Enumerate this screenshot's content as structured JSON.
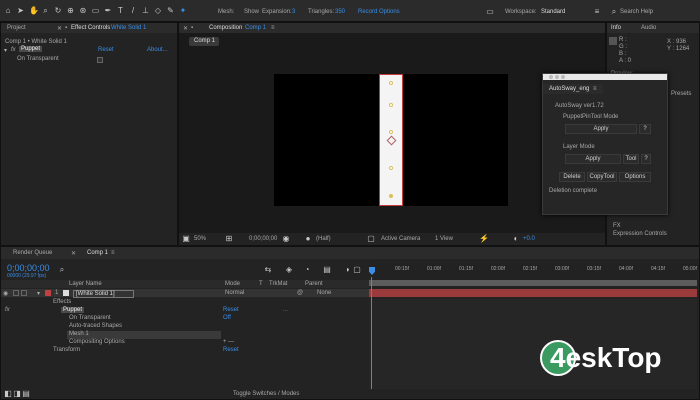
{
  "toolbar": {
    "tools": [
      "home-icon",
      "selection-icon",
      "hand-icon",
      "zoom-icon",
      "rotate-icon",
      "camera-icon",
      "pan-behind-icon",
      "rectangle-icon",
      "pen-icon",
      "type-icon",
      "brush-icon",
      "clone-stamp-icon",
      "eraser-icon",
      "roto-brush-icon",
      "puppet-pin-icon"
    ],
    "mesh_label": "Mesh:",
    "show_label": "Show",
    "expansion_label": "Expansion:",
    "expansion_value": "3",
    "triangles_label": "Triangles:",
    "triangles_value": "350",
    "record_options": "Record Options",
    "workspace_label": "Workspace:",
    "workspace_value": "Standard",
    "search_help": "Search Help"
  },
  "project_panel": {
    "tab_project": "Project",
    "tab_effect_controls": "Effect Controls",
    "effect_layer": "White Solid 1",
    "breadcrumb": "Comp 1 • White Solid 1",
    "effect_name": "Puppet",
    "reset": "Reset",
    "about": "About...",
    "on_transparent": "On Transparent"
  },
  "composition": {
    "tab_label": "Composition",
    "comp_name": "Comp 1",
    "sub_tab": "Comp 1",
    "zoom": "50%",
    "timecode": "0;00;00;00",
    "resolution": "(Half)",
    "camera": "Active Camera",
    "view": "1 View",
    "exposure": "+0.0"
  },
  "info_panel": {
    "tab_info": "Info",
    "tab_audio": "Audio",
    "r": "R :",
    "g": "G :",
    "b": "B :",
    "a": "A : 0",
    "x": "X : 936",
    "y": "Y : 1264",
    "preview": "Preview",
    "presets": "Presets",
    "item_fx": "FX",
    "item_expression": "Expression Controls"
  },
  "autosway": {
    "window_title": "AutoSway_eng",
    "version": "AutoSway ver1.72",
    "puppet_mode": "PuppetPinTool Mode",
    "apply1": "Apply",
    "help1": "?",
    "layer_mode": "Layer Mode",
    "apply2": "Apply",
    "tool": "Tool",
    "help2": "?",
    "delete": "Delete",
    "copy_tool": "CopyTool",
    "options": "Options",
    "status": "Deletion complete"
  },
  "timeline": {
    "tab_render_queue": "Render Queue",
    "tab_comp": "Comp 1",
    "timecode": "0;00;00;00",
    "fps": "00000 (29.97 fps)",
    "col_layer_name": "Layer Name",
    "col_mode": "Mode",
    "col_t": "T",
    "col_trkmat": "TrkMat",
    "col_parent": "Parent",
    "layer_number": "1",
    "layer_name": "[White Solid 1]",
    "layer_mode": "Normal",
    "parent": "None",
    "effects": "Effects",
    "puppet": "Puppet",
    "reset1": "Reset",
    "about": "...",
    "on_transparent": "On Transparent",
    "off": "Off",
    "auto_traced": "Auto-traced Shapes",
    "mesh": "Mesh 1",
    "compositing": "Compositing Options",
    "plus_minus": "+ —",
    "transform": "Transform",
    "reset2": "Reset",
    "toggle_label": "Toggle Switches / Modes",
    "ruler": [
      "00:15f",
      "01:00f",
      "01:15f",
      "02:00f",
      "02:15f",
      "03:00f",
      "03:15f",
      "04:00f",
      "04:15f",
      "05:00f"
    ]
  },
  "watermark": {
    "brand": "4eskTop"
  }
}
